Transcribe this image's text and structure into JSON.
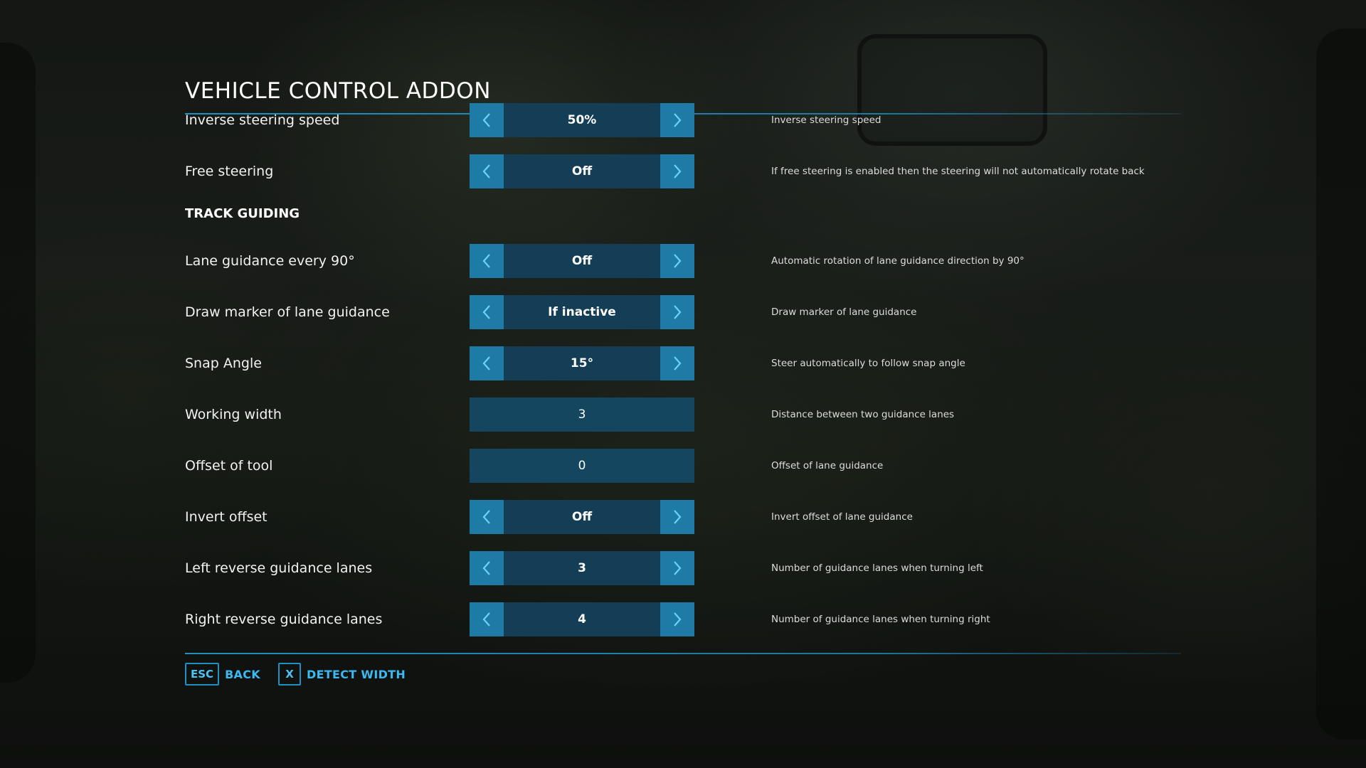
{
  "screen": {
    "title": "VEHICLE CONTROL ADDON"
  },
  "rows_top": [
    {
      "label": "Inverse steering speed",
      "value": "50%",
      "description": "Inverse steering speed"
    },
    {
      "label": "Free steering",
      "value": "Off",
      "description": "If free steering is enabled then the steering will not automatically rotate back"
    }
  ],
  "section": {
    "title": "TRACK GUIDING"
  },
  "rows_track": [
    {
      "label": "Lane guidance every 90°",
      "value": "Off",
      "description": "Automatic rotation of lane guidance direction by 90°"
    },
    {
      "label": "Draw marker of lane guidance",
      "value": "If inactive",
      "description": "Draw marker of lane guidance"
    },
    {
      "label": "Snap Angle",
      "value": "15°",
      "description": "Steer automatically to follow snap angle"
    },
    {
      "label": "Working width",
      "value": "3",
      "description": "Distance between two guidance lanes"
    },
    {
      "label": "Offset of tool",
      "value": "0",
      "description": "Offset of lane guidance"
    },
    {
      "label": "Invert offset",
      "value": "Off",
      "description": "Invert offset of lane guidance"
    },
    {
      "label": "Left reverse guidance lanes",
      "value": "3",
      "description": "Number of guidance lanes when turning left"
    },
    {
      "label": "Right reverse guidance lanes",
      "value": "4",
      "description": "Number of guidance lanes when turning right"
    }
  ],
  "footer": {
    "back_key": "ESC",
    "back_label": "BACK",
    "detect_key": "X",
    "detect_label": "DETECT WIDTH"
  },
  "icons": {
    "left": "chevron-left-icon",
    "right": "chevron-right-icon"
  },
  "colors": {
    "accent": "#1d7ba6",
    "value_bg": "#143e55",
    "line": "#2296c8",
    "footer_text": "#3ab9f2"
  }
}
